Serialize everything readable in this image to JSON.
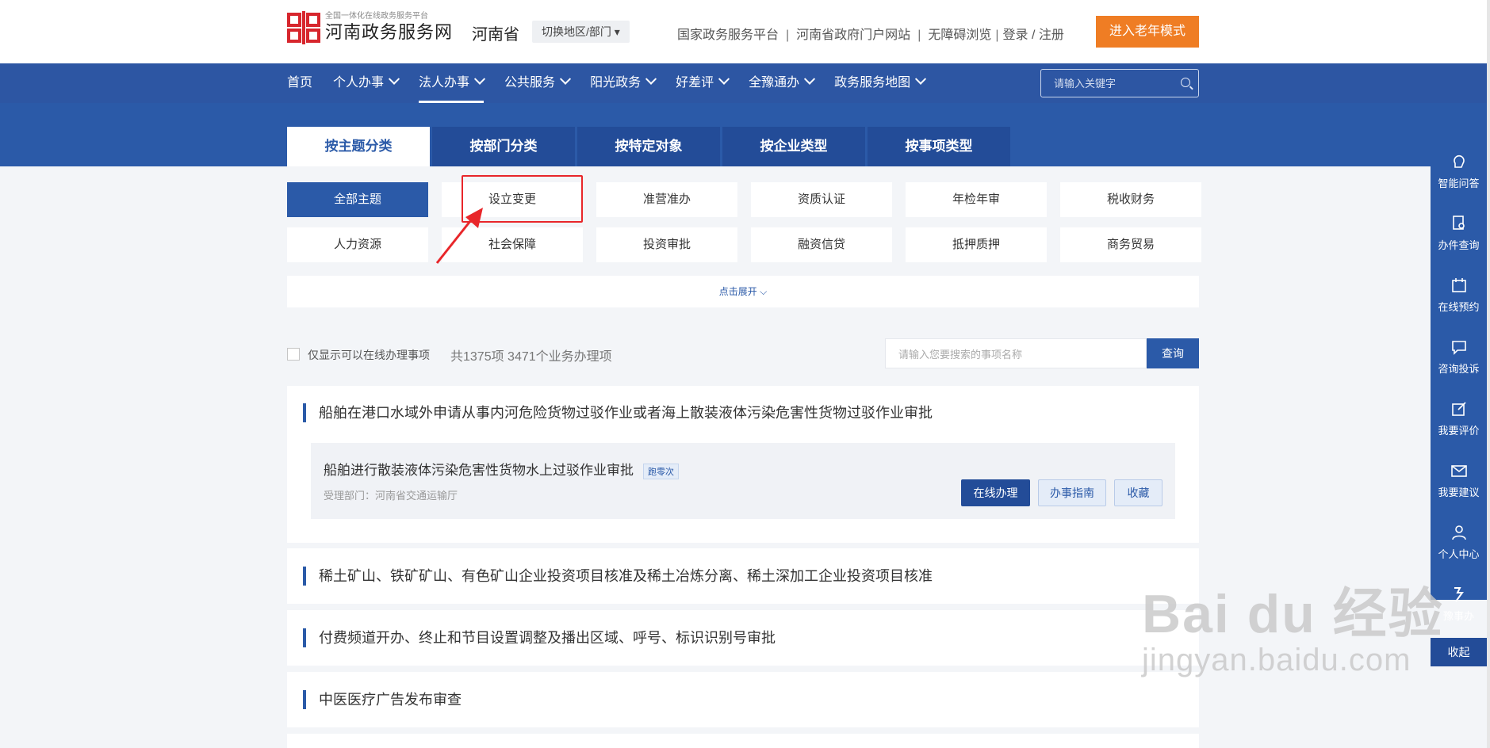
{
  "header": {
    "logo_tagline": "全国一体化在线政务服务平台",
    "logo_title": "河南政务服务网",
    "province": "河南省",
    "switch_region": "切换地区/部门",
    "links": [
      "国家政务服务平台",
      "河南省政府门户网站",
      "无障碍浏览",
      "登录 / 注册"
    ],
    "elder_mode": "进入老年模式"
  },
  "nav": {
    "items": [
      {
        "label": "首页",
        "has_dropdown": false
      },
      {
        "label": "个人办事",
        "has_dropdown": true
      },
      {
        "label": "法人办事",
        "has_dropdown": true,
        "active": true
      },
      {
        "label": "公共服务",
        "has_dropdown": true
      },
      {
        "label": "阳光政务",
        "has_dropdown": true
      },
      {
        "label": "好差评",
        "has_dropdown": true
      },
      {
        "label": "全豫通办",
        "has_dropdown": true
      },
      {
        "label": "政务服务地图",
        "has_dropdown": true
      }
    ],
    "search_placeholder": "请输入关键字"
  },
  "category_tabs": [
    "按主题分类",
    "按部门分类",
    "按特定对象",
    "按企业类型",
    "按事项类型"
  ],
  "themes": [
    "全部主题",
    "设立变更",
    "准营准办",
    "资质认证",
    "年检年审",
    "税收财务",
    "人力资源",
    "社会保障",
    "投资审批",
    "融资信贷",
    "抵押质押",
    "商务贸易"
  ],
  "expand_label": "点击展开",
  "filter": {
    "online_only": "仅显示可以在线办理事项",
    "totals": "共1375项 3471个业务办理项",
    "search_placeholder": "请输入您要搜索的事项名称",
    "query_button": "查询"
  },
  "items": [
    {
      "title": "船舶在港口水域外申请从事内河危险货物过驳作业或者海上散装液体污染危害性货物过驳作业审批",
      "sub": {
        "title": "船舶进行散装液体污染危害性货物水上过驳作业审批",
        "badge": "跑零次",
        "dept": "受理部门：河南省交通运输厅",
        "online": "在线办理",
        "guide": "办事指南",
        "favorite": "收藏"
      }
    },
    {
      "title": "稀土矿山、铁矿矿山、有色矿山企业投资项目核准及稀土冶炼分离、稀土深加工企业投资项目核准"
    },
    {
      "title": "付费频道开办、终止和节目设置调整及播出区域、呼号、标识识别号审批"
    },
    {
      "title": "中医医疗广告发布审查"
    }
  ],
  "sidebar": {
    "items": [
      "智能问答",
      "办件查询",
      "在线预约",
      "咨询投诉",
      "我要评价",
      "我要建议",
      "个人中心",
      "豫事办"
    ],
    "collapse": "收起"
  },
  "watermark": {
    "main": "Bai du 经验",
    "sub": "jingyan.baidu.com"
  },
  "colors": {
    "primary": "#2b5aa8",
    "accent": "#ef7d24",
    "highlight": "#e8262a"
  }
}
